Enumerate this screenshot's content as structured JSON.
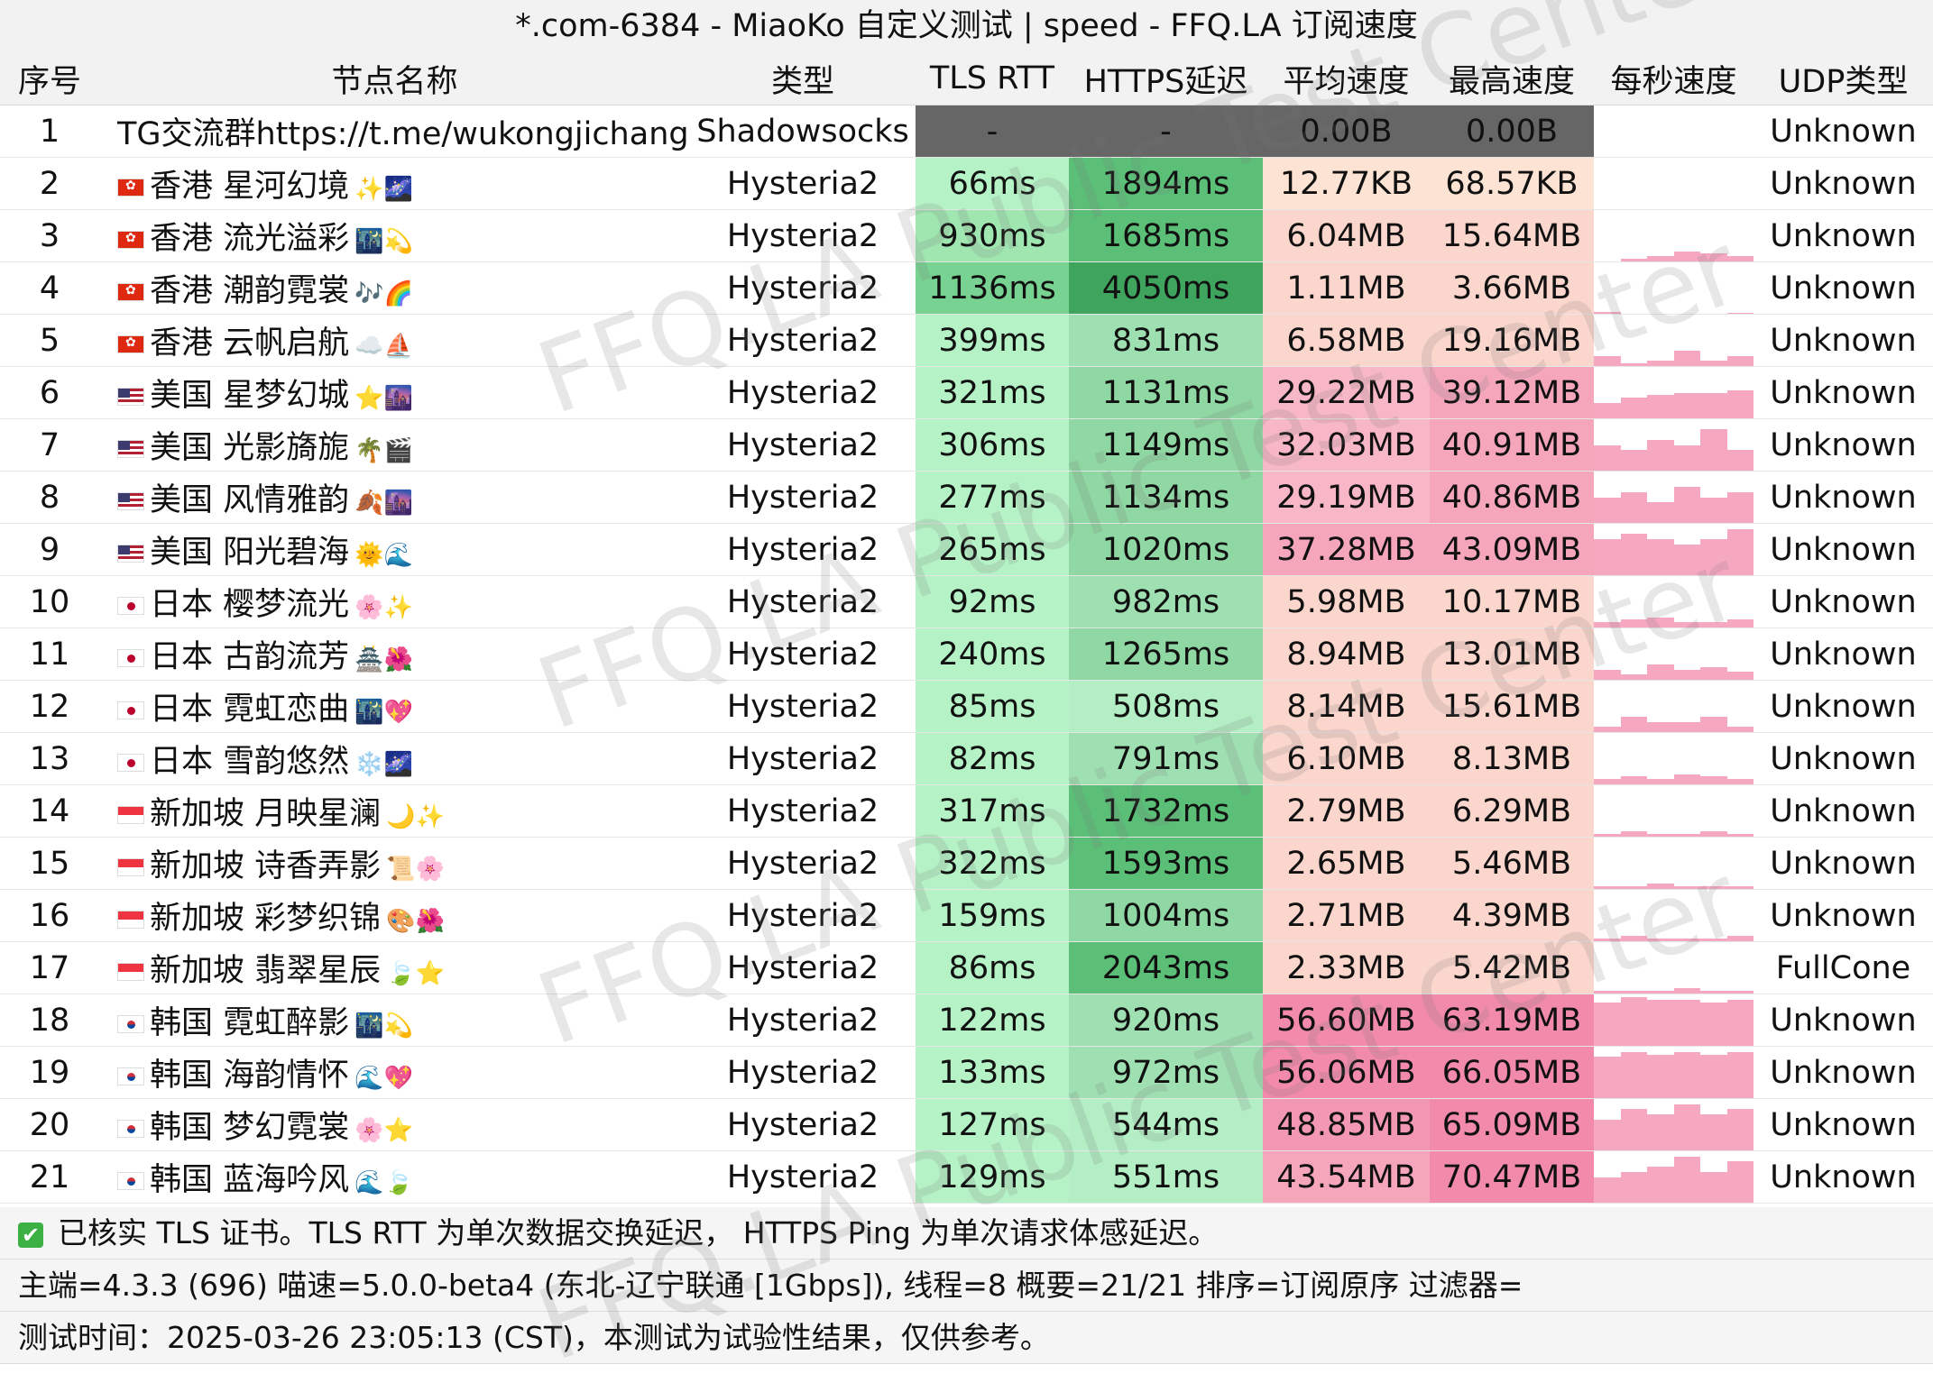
{
  "title": "*.com-6384 - MiaoKo 自定义测试 | speed - FFQ.LA 订阅速度",
  "columns": [
    "序号",
    "节点名称",
    "类型",
    "TLS RTT",
    "HTTPS延迟",
    "平均速度",
    "最高速度",
    "每秒速度",
    "UDP类型"
  ],
  "rows": [
    {
      "no": "1",
      "flag": "",
      "name": "TG交流群https://t.me/wukongjichang",
      "emoji": "",
      "type": "Shadowsocks",
      "tls": "-",
      "https": "-",
      "avg": "0.00B",
      "max": "0.00B",
      "spark": [],
      "udp": "Unknown"
    },
    {
      "no": "2",
      "flag": "hk",
      "name": "香港 星河幻境",
      "emoji": "✨🌌",
      "type": "Hysteria2",
      "tls": "66ms",
      "https": "1894ms",
      "avg": "12.77KB",
      "max": "68.57KB",
      "spark": [],
      "udp": "Unknown"
    },
    {
      "no": "3",
      "flag": "hk",
      "name": "香港 流光溢彩",
      "emoji": "🌃💫",
      "type": "Hysteria2",
      "tls": "930ms",
      "https": "1685ms",
      "avg": "6.04MB",
      "max": "15.64MB",
      "spark": [
        0,
        0.05,
        0.1,
        0.2,
        0.15,
        0.1
      ],
      "udp": "Unknown"
    },
    {
      "no": "4",
      "flag": "hk",
      "name": "香港 潮韵霓裳",
      "emoji": "🎶🌈",
      "type": "Hysteria2",
      "tls": "1136ms",
      "https": "4050ms",
      "avg": "1.11MB",
      "max": "3.66MB",
      "spark": [
        0.03,
        0,
        0,
        0,
        0,
        0.02
      ],
      "udp": "Unknown"
    },
    {
      "no": "5",
      "flag": "hk",
      "name": "香港 云帆启航",
      "emoji": "☁️⛵",
      "type": "Hysteria2",
      "tls": "399ms",
      "https": "831ms",
      "avg": "6.58MB",
      "max": "19.16MB",
      "spark": [
        0.2,
        0.05,
        0.1,
        0.3,
        0.1,
        0.2
      ],
      "udp": "Unknown"
    },
    {
      "no": "6",
      "flag": "us",
      "name": "美国 星梦幻城",
      "emoji": "⭐🌆",
      "type": "Hysteria2",
      "tls": "321ms",
      "https": "1131ms",
      "avg": "29.22MB",
      "max": "39.12MB",
      "spark": [
        0.3,
        0.4,
        0.45,
        0.5,
        0.5,
        0.55
      ],
      "udp": "Unknown"
    },
    {
      "no": "7",
      "flag": "us",
      "name": "美国 光影旖旎",
      "emoji": "🌴🎬",
      "type": "Hysteria2",
      "tls": "306ms",
      "https": "1149ms",
      "avg": "32.03MB",
      "max": "40.91MB",
      "spark": [
        0.5,
        0.4,
        0.6,
        0.5,
        0.8,
        0.4
      ],
      "udp": "Unknown"
    },
    {
      "no": "8",
      "flag": "us",
      "name": "美国 风情雅韵",
      "emoji": "🍂🌆",
      "type": "Hysteria2",
      "tls": "277ms",
      "https": "1134ms",
      "avg": "29.19MB",
      "max": "40.86MB",
      "spark": [
        0.5,
        0.6,
        0.4,
        0.7,
        0.5,
        0.6
      ],
      "udp": "Unknown"
    },
    {
      "no": "9",
      "flag": "us",
      "name": "美国 阳光碧海",
      "emoji": "🌞🌊",
      "type": "Hysteria2",
      "tls": "265ms",
      "https": "1020ms",
      "avg": "37.28MB",
      "max": "43.09MB",
      "spark": [
        0.7,
        0.8,
        0.7,
        0.6,
        0.7,
        0.9
      ],
      "udp": "Unknown"
    },
    {
      "no": "10",
      "flag": "jp",
      "name": "日本 樱梦流光",
      "emoji": "🌸✨",
      "type": "Hysteria2",
      "tls": "92ms",
      "https": "982ms",
      "avg": "5.98MB",
      "max": "10.17MB",
      "spark": [
        0.1,
        0.15,
        0.2,
        0.1,
        0.1,
        0.15
      ],
      "udp": "Unknown"
    },
    {
      "no": "11",
      "flag": "jp",
      "name": "日本 古韵流芳",
      "emoji": "🏯🌺",
      "type": "Hysteria2",
      "tls": "240ms",
      "https": "1265ms",
      "avg": "8.94MB",
      "max": "13.01MB",
      "spark": [
        0.2,
        0.1,
        0.3,
        0.2,
        0.25,
        0.15
      ],
      "udp": "Unknown"
    },
    {
      "no": "12",
      "flag": "jp",
      "name": "日本 霓虹恋曲",
      "emoji": "🌃💖",
      "type": "Hysteria2",
      "tls": "85ms",
      "https": "508ms",
      "avg": "8.14MB",
      "max": "15.61MB",
      "spark": [
        0.1,
        0.3,
        0.2,
        0.2,
        0.3,
        0.1
      ],
      "udp": "Unknown"
    },
    {
      "no": "13",
      "flag": "jp",
      "name": "日本 雪韵悠然",
      "emoji": "❄️🌌",
      "type": "Hysteria2",
      "tls": "82ms",
      "https": "791ms",
      "avg": "6.10MB",
      "max": "8.13MB",
      "spark": [
        0.1,
        0.15,
        0.1,
        0.2,
        0.15,
        0.1
      ],
      "udp": "Unknown"
    },
    {
      "no": "14",
      "flag": "sg",
      "name": "新加坡 月映星澜",
      "emoji": "🌙✨",
      "type": "Hysteria2",
      "tls": "317ms",
      "https": "1732ms",
      "avg": "2.79MB",
      "max": "6.29MB",
      "spark": [
        0.05,
        0.1,
        0.05,
        0.05,
        0.1,
        0.05
      ],
      "udp": "Unknown"
    },
    {
      "no": "15",
      "flag": "sg",
      "name": "新加坡 诗香弄影",
      "emoji": "📜🌸",
      "type": "Hysteria2",
      "tls": "322ms",
      "https": "1593ms",
      "avg": "2.65MB",
      "max": "5.46MB",
      "spark": [
        0.05,
        0.05,
        0.1,
        0.05,
        0.05,
        0.05
      ],
      "udp": "Unknown"
    },
    {
      "no": "16",
      "flag": "sg",
      "name": "新加坡 彩梦织锦",
      "emoji": "🎨🌺",
      "type": "Hysteria2",
      "tls": "159ms",
      "https": "1004ms",
      "avg": "2.71MB",
      "max": "4.39MB",
      "spark": [
        0.05,
        0.1,
        0.05,
        0.05,
        0.05,
        0.1
      ],
      "udp": "Unknown"
    },
    {
      "no": "17",
      "flag": "sg",
      "name": "新加坡 翡翠星辰",
      "emoji": "🍃⭐",
      "type": "Hysteria2",
      "tls": "86ms",
      "https": "2043ms",
      "avg": "2.33MB",
      "max": "5.42MB",
      "spark": [
        0.05,
        0.05,
        0.05,
        0.1,
        0.05,
        0.05
      ],
      "udp": "FullCone"
    },
    {
      "no": "18",
      "flag": "kr",
      "name": "韩国 霓虹醉影",
      "emoji": "🌃💫",
      "type": "Hysteria2",
      "tls": "122ms",
      "https": "920ms",
      "avg": "56.60MB",
      "max": "63.19MB",
      "spark": [
        0.85,
        0.95,
        0.9,
        0.9,
        0.85,
        0.9
      ],
      "udp": "Unknown"
    },
    {
      "no": "19",
      "flag": "kr",
      "name": "韩国 海韵情怀",
      "emoji": "🌊💖",
      "type": "Hysteria2",
      "tls": "133ms",
      "https": "972ms",
      "avg": "56.06MB",
      "max": "66.05MB",
      "spark": [
        0.8,
        0.9,
        0.85,
        0.9,
        0.85,
        0.9
      ],
      "udp": "Unknown"
    },
    {
      "no": "20",
      "flag": "kr",
      "name": "韩国 梦幻霓裳",
      "emoji": "🌸⭐",
      "type": "Hysteria2",
      "tls": "127ms",
      "https": "544ms",
      "avg": "48.85MB",
      "max": "65.09MB",
      "spark": [
        0.6,
        0.8,
        0.7,
        0.9,
        0.7,
        0.8
      ],
      "udp": "Unknown"
    },
    {
      "no": "21",
      "flag": "kr",
      "name": "韩国 蓝海吟风",
      "emoji": "🌊🍃",
      "type": "Hysteria2",
      "tls": "129ms",
      "https": "551ms",
      "avg": "43.54MB",
      "max": "70.47MB",
      "spark": [
        0.5,
        0.6,
        0.7,
        0.9,
        0.6,
        0.8
      ],
      "udp": "Unknown"
    }
  ],
  "footer": {
    "line1": "已核实 TLS 证书。TLS RTT 为单次数据交换延迟， HTTPS Ping 为单次请求体感延迟。",
    "line2": "主端=4.3.3 (696) 喵速=5.0.0-beta4 (东北-辽宁联通 [1Gbps]), 线程=8 概要=21/21 排序=订阅原序 过滤器=",
    "line3": "测试时间：2025-03-26 23:05:13 (CST)，本测试为试验性结果，仅供参考。"
  },
  "watermark": [
    "FFQ.LA Public Test Center",
    "FFQ.LA Public Test Center",
    "FFQ.LA Public Test Center",
    "FFQ.LA Public Test Center"
  ],
  "colors": {
    "header_bg": "#f2f2f2",
    "gray_cell": "#666666",
    "spark": "#f7a8c1"
  }
}
